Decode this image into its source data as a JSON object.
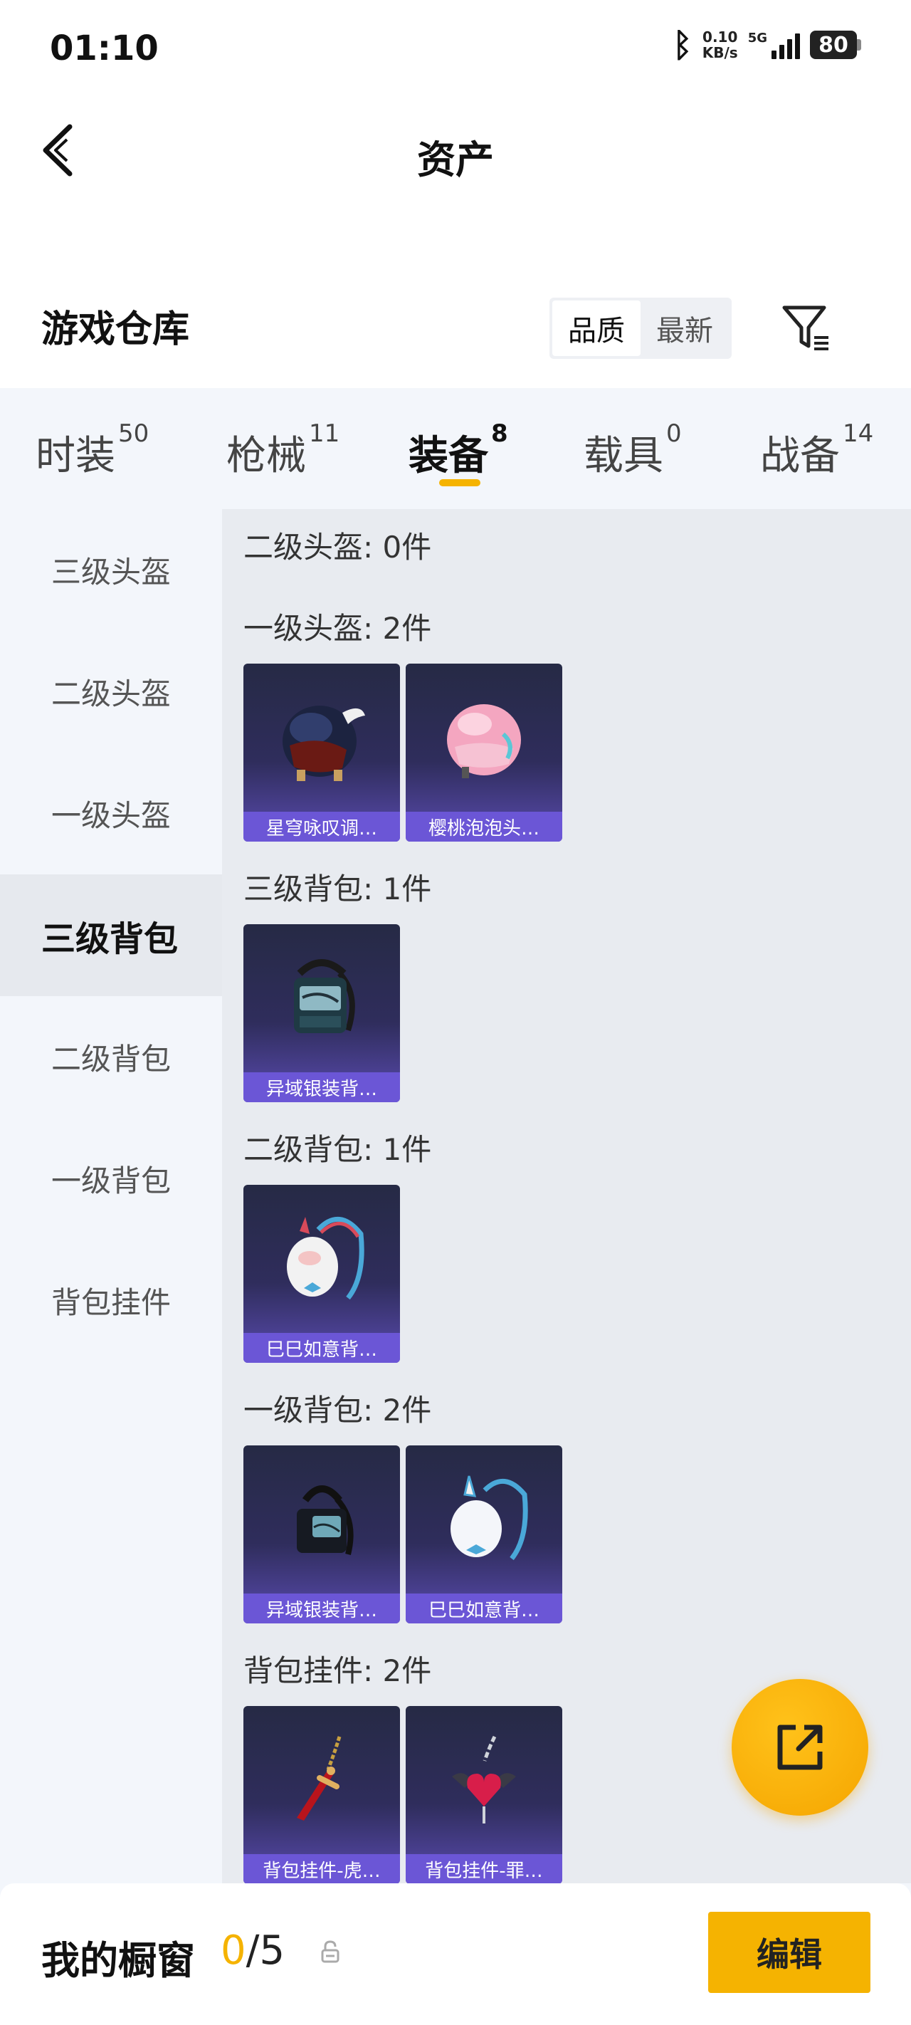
{
  "status_bar": {
    "time": "01:10",
    "net_speed_value": "0.10",
    "net_speed_unit": "KB/s",
    "network": "5G",
    "battery": "80"
  },
  "nav": {
    "title": "资产",
    "back_icon": "chevron-left-icon"
  },
  "section": {
    "title": "游戏仓库",
    "sort_options": [
      "品质",
      "最新"
    ],
    "active_sort": "品质",
    "filter_icon": "filter-icon"
  },
  "tabs": [
    {
      "label": "时装",
      "count": "50"
    },
    {
      "label": "枪械",
      "count": "11"
    },
    {
      "label": "装备",
      "count": "8",
      "active": true
    },
    {
      "label": "载具",
      "count": "0"
    },
    {
      "label": "战备",
      "count": "14"
    }
  ],
  "side_menu": [
    {
      "label": "三级头盔"
    },
    {
      "label": "二级头盔"
    },
    {
      "label": "一级头盔"
    },
    {
      "label": "三级背包",
      "active": true
    },
    {
      "label": "二级背包"
    },
    {
      "label": "一级背包"
    },
    {
      "label": "背包挂件"
    }
  ],
  "groups": [
    {
      "label": "二级头盔: 0件",
      "items": []
    },
    {
      "label": "一级头盔: 2件",
      "items": [
        {
          "name": "星穹咏叹调…",
          "icon": "helmet-dark-icon"
        },
        {
          "name": "樱桃泡泡头…",
          "icon": "helmet-pink-icon"
        }
      ]
    },
    {
      "label": "三级背包: 1件",
      "items": [
        {
          "name": "异域银装背…",
          "icon": "backpack-icon"
        }
      ]
    },
    {
      "label": "二级背包: 1件",
      "items": [
        {
          "name": "巳巳如意背…",
          "icon": "bunny-backpack-icon"
        }
      ]
    },
    {
      "label": "一级背包: 2件",
      "items": [
        {
          "name": "异域银装背…",
          "icon": "backpack-icon"
        },
        {
          "name": "巳巳如意背…",
          "icon": "bunny-backpack-icon"
        }
      ]
    },
    {
      "label": "背包挂件: 2件",
      "items": [
        {
          "name": "背包挂件-虎…",
          "icon": "sword-charm-icon"
        },
        {
          "name": "背包挂件-罪…",
          "icon": "heart-charm-icon"
        }
      ]
    }
  ],
  "fab": {
    "icon": "share-icon"
  },
  "showcase": {
    "title": "我的橱窗",
    "current": "0",
    "separator": "/",
    "total": "5",
    "lock_icon": "lock-icon",
    "edit_label": "编辑"
  },
  "colors": {
    "accent": "#f5b301",
    "card_top": "#262a45",
    "card_bottom": "#5a4bb0",
    "card_label": "#6b56d6"
  }
}
